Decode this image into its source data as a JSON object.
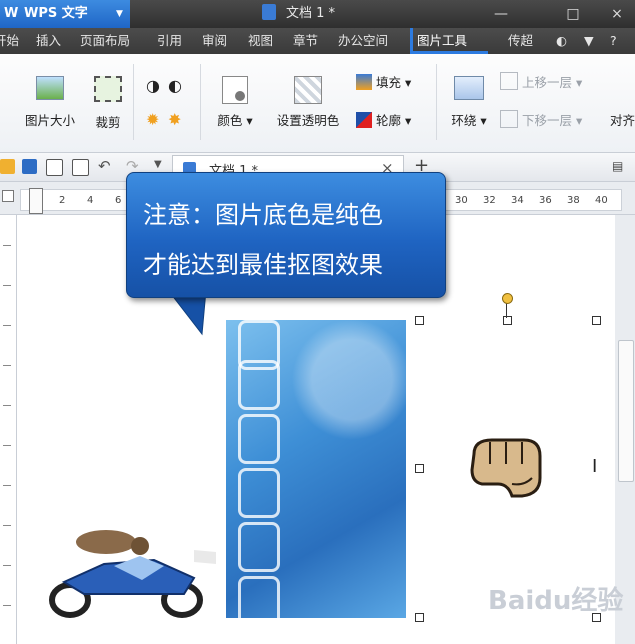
{
  "app": {
    "name": "WPS 文字",
    "glyph": "W"
  },
  "window": {
    "title": "文档 1 *",
    "controls": [
      "—",
      "□",
      "×"
    ]
  },
  "menu": {
    "items": [
      "开始",
      "插入",
      "页面布局",
      "引用",
      "审阅",
      "视图",
      "章节",
      "办公空间",
      "图片工具"
    ],
    "active": "图片工具",
    "right_items": [
      "传超",
      "?"
    ]
  },
  "ribbon": {
    "picture_size": "图片大小",
    "crop": "裁剪",
    "color": "颜色",
    "set_transparent": "设置透明色",
    "fill": "填充",
    "outline": "轮廓",
    "wrap": "环绕",
    "bring_forward": "上移一层",
    "send_backward": "下移一层",
    "align": "对齐",
    "dropdown_glyph": "▾"
  },
  "quick_toolbar": {
    "tab_label": "文档 1 *",
    "tab_close": "×",
    "new_tab": "+"
  },
  "ruler": {
    "ticks": [
      "2",
      "4",
      "6",
      "30",
      "32",
      "34",
      "36",
      "38",
      "40"
    ]
  },
  "callout": {
    "line1": "注意：图片底色是纯色",
    "line2": "才能达到最佳抠图效果"
  },
  "watermark": "Baidu经验",
  "colors": {
    "accent": "#2d7be0",
    "callout": "#1f64c2",
    "titlebar": "#3a3a3a"
  }
}
